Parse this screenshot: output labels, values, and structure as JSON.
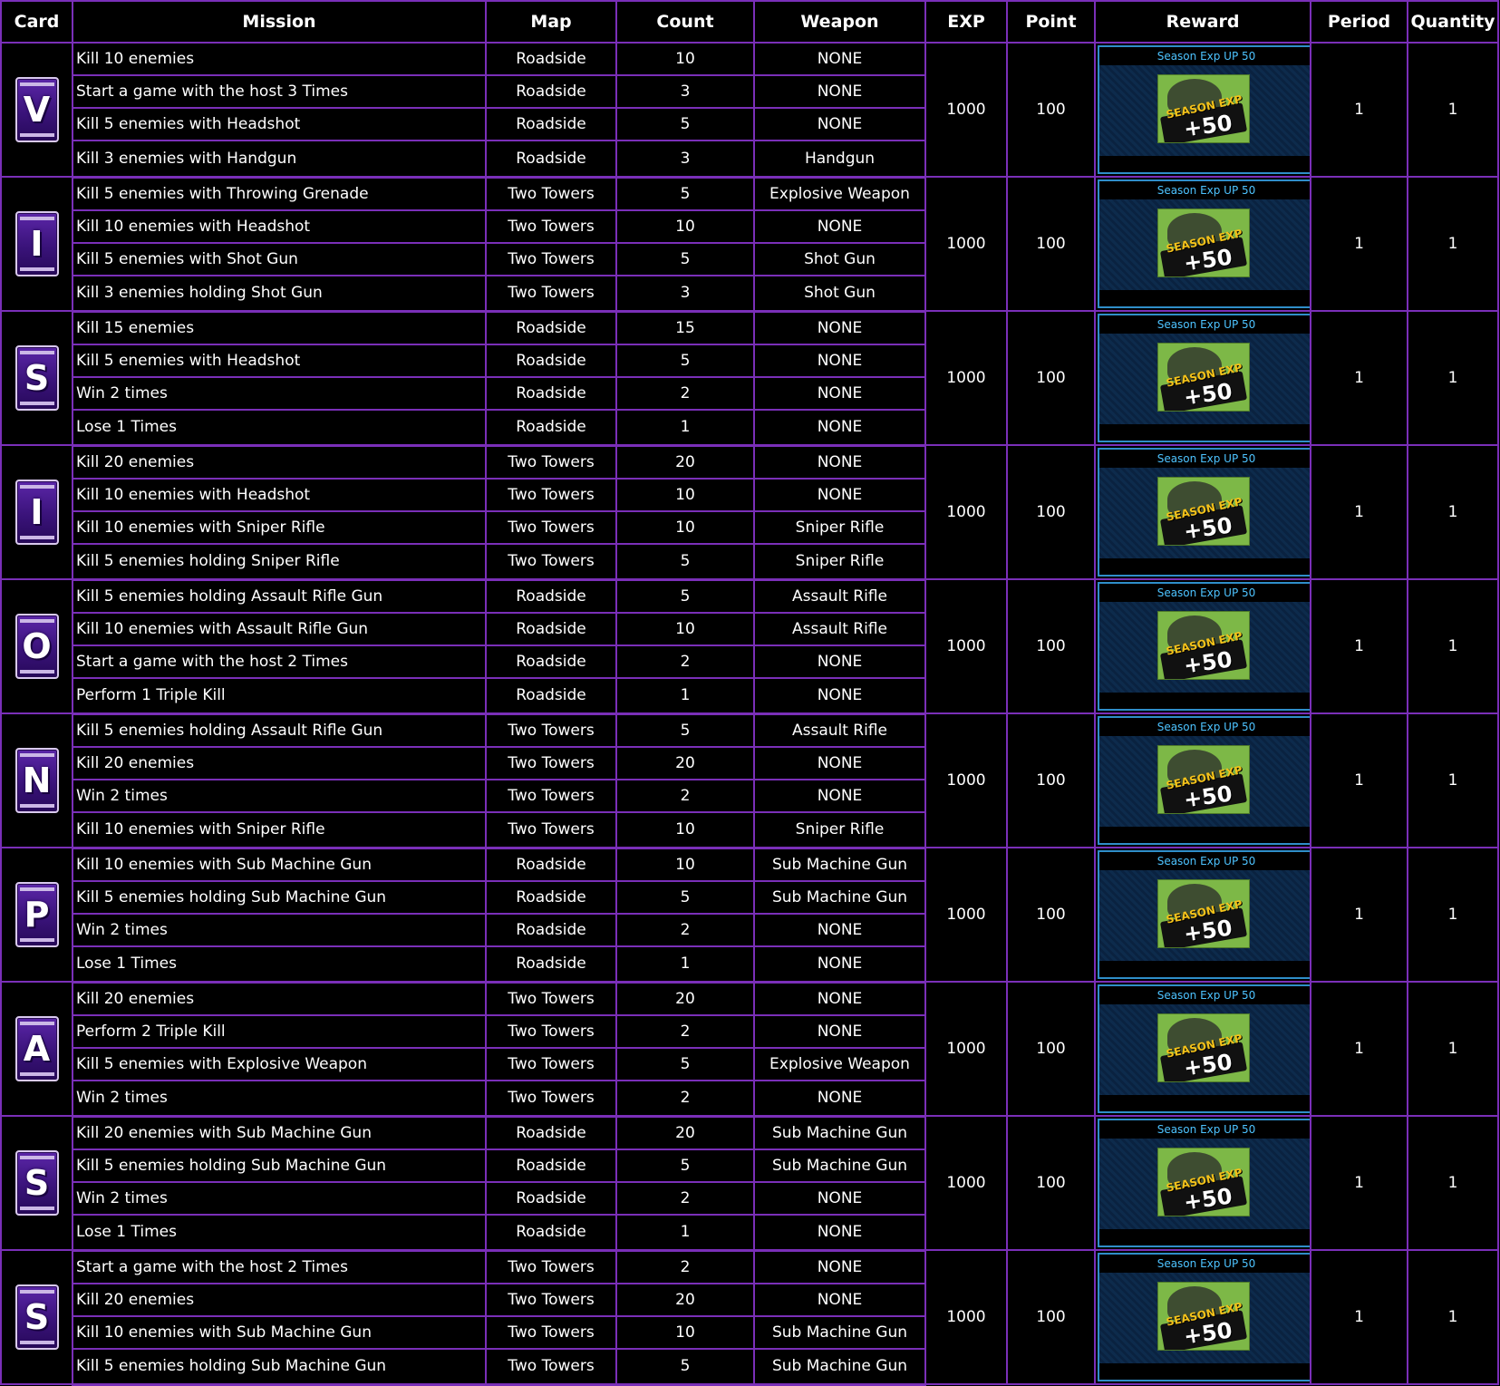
{
  "headers": [
    "Card",
    "Mission",
    "Map",
    "Count",
    "Weapon",
    "EXP",
    "Point",
    "Reward",
    "Period",
    "Quantity"
  ],
  "reward": {
    "title": "Season Exp UP 50",
    "icon_label": "SEASON EXP",
    "icon_amount": "+50"
  },
  "colors": {
    "border": "#7a2fb8",
    "card_purple": "#4a1c96",
    "reward_text": "#4dc3ff",
    "reward_frame": "#2f8ec9"
  },
  "groups": [
    {
      "card": "V",
      "exp": "1000",
      "point": "100",
      "period": "1",
      "quantity": "1",
      "missions": [
        {
          "mission": "Kill 10 enemies",
          "map": "Roadside",
          "count": "10",
          "weapon": "NONE"
        },
        {
          "mission": "Start a game with the host 3 Times",
          "map": "Roadside",
          "count": "3",
          "weapon": "NONE"
        },
        {
          "mission": "Kill 5 enemies with Headshot",
          "map": "Roadside",
          "count": "5",
          "weapon": "NONE"
        },
        {
          "mission": "Kill 3 enemies with Handgun",
          "map": "Roadside",
          "count": "3",
          "weapon": "Handgun"
        }
      ]
    },
    {
      "card": "I",
      "exp": "1000",
      "point": "100",
      "period": "1",
      "quantity": "1",
      "missions": [
        {
          "mission": "Kill 5 enemies with Throwing Grenade",
          "map": "Two Towers",
          "count": "5",
          "weapon": "Explosive Weapon"
        },
        {
          "mission": "Kill 10 enemies with Headshot",
          "map": "Two Towers",
          "count": "10",
          "weapon": "NONE"
        },
        {
          "mission": "Kill 5 enemies with Shot Gun",
          "map": "Two Towers",
          "count": "5",
          "weapon": "Shot Gun"
        },
        {
          "mission": "Kill 3 enemies holding Shot Gun",
          "map": "Two Towers",
          "count": "3",
          "weapon": "Shot Gun"
        }
      ]
    },
    {
      "card": "S",
      "exp": "1000",
      "point": "100",
      "period": "1",
      "quantity": "1",
      "missions": [
        {
          "mission": "Kill 15 enemies",
          "map": "Roadside",
          "count": "15",
          "weapon": "NONE"
        },
        {
          "mission": "Kill 5 enemies with Headshot",
          "map": "Roadside",
          "count": "5",
          "weapon": "NONE"
        },
        {
          "mission": "Win 2 times",
          "map": "Roadside",
          "count": "2",
          "weapon": "NONE"
        },
        {
          "mission": "Lose 1 Times",
          "map": "Roadside",
          "count": "1",
          "weapon": "NONE"
        }
      ]
    },
    {
      "card": "I",
      "exp": "1000",
      "point": "100",
      "period": "1",
      "quantity": "1",
      "missions": [
        {
          "mission": "Kill 20 enemies",
          "map": "Two Towers",
          "count": "20",
          "weapon": "NONE"
        },
        {
          "mission": "Kill 10 enemies with Headshot",
          "map": "Two Towers",
          "count": "10",
          "weapon": "NONE"
        },
        {
          "mission": "Kill 10 enemies with Sniper Rifle",
          "map": "Two Towers",
          "count": "10",
          "weapon": "Sniper Rifle"
        },
        {
          "mission": "Kill 5 enemies holding Sniper Rifle",
          "map": "Two Towers",
          "count": "5",
          "weapon": "Sniper Rifle"
        }
      ]
    },
    {
      "card": "O",
      "exp": "1000",
      "point": "100",
      "period": "1",
      "quantity": "1",
      "missions": [
        {
          "mission": "Kill 5 enemies holding Assault Rifle Gun",
          "map": "Roadside",
          "count": "5",
          "weapon": "Assault Rifle"
        },
        {
          "mission": "Kill 10 enemies with Assault Rifle Gun",
          "map": "Roadside",
          "count": "10",
          "weapon": "Assault Rifle"
        },
        {
          "mission": "Start a game with the host 2 Times",
          "map": "Roadside",
          "count": "2",
          "weapon": "NONE"
        },
        {
          "mission": "Perform 1 Triple Kill",
          "map": "Roadside",
          "count": "1",
          "weapon": "NONE"
        }
      ]
    },
    {
      "card": "N",
      "exp": "1000",
      "point": "100",
      "period": "1",
      "quantity": "1",
      "missions": [
        {
          "mission": "Kill 5 enemies holding Assault Rifle Gun",
          "map": "Two Towers",
          "count": "5",
          "weapon": "Assault Rifle"
        },
        {
          "mission": "Kill 20 enemies",
          "map": "Two Towers",
          "count": "20",
          "weapon": "NONE"
        },
        {
          "mission": "Win 2 times",
          "map": "Two Towers",
          "count": "2",
          "weapon": "NONE"
        },
        {
          "mission": "Kill 10 enemies with Sniper Rifle",
          "map": "Two Towers",
          "count": "10",
          "weapon": "Sniper Rifle"
        }
      ]
    },
    {
      "card": "P",
      "exp": "1000",
      "point": "100",
      "period": "1",
      "quantity": "1",
      "missions": [
        {
          "mission": "Kill 10 enemies with Sub Machine Gun",
          "map": "Roadside",
          "count": "10",
          "weapon": "Sub Machine Gun"
        },
        {
          "mission": "Kill 5 enemies holding Sub Machine Gun",
          "map": "Roadside",
          "count": "5",
          "weapon": "Sub Machine Gun"
        },
        {
          "mission": "Win 2 times",
          "map": "Roadside",
          "count": "2",
          "weapon": "NONE"
        },
        {
          "mission": "Lose 1 Times",
          "map": "Roadside",
          "count": "1",
          "weapon": "NONE"
        }
      ]
    },
    {
      "card": "A",
      "exp": "1000",
      "point": "100",
      "period": "1",
      "quantity": "1",
      "missions": [
        {
          "mission": "Kill 20 enemies",
          "map": "Two Towers",
          "count": "20",
          "weapon": "NONE"
        },
        {
          "mission": "Perform 2 Triple Kill",
          "map": "Two Towers",
          "count": "2",
          "weapon": "NONE"
        },
        {
          "mission": "Kill 5 enemies with Explosive Weapon",
          "map": "Two Towers",
          "count": "5",
          "weapon": "Explosive Weapon"
        },
        {
          "mission": "Win 2 times",
          "map": "Two Towers",
          "count": "2",
          "weapon": "NONE"
        }
      ]
    },
    {
      "card": "S",
      "exp": "1000",
      "point": "100",
      "period": "1",
      "quantity": "1",
      "missions": [
        {
          "mission": "Kill 20 enemies with Sub Machine Gun",
          "map": "Roadside",
          "count": "20",
          "weapon": "Sub Machine Gun"
        },
        {
          "mission": "Kill 5 enemies holding Sub Machine Gun",
          "map": "Roadside",
          "count": "5",
          "weapon": "Sub Machine Gun"
        },
        {
          "mission": "Win 2 times",
          "map": "Roadside",
          "count": "2",
          "weapon": "NONE"
        },
        {
          "mission": "Lose 1 Times",
          "map": "Roadside",
          "count": "1",
          "weapon": "NONE"
        }
      ]
    },
    {
      "card": "S",
      "exp": "1000",
      "point": "100",
      "period": "1",
      "quantity": "1",
      "missions": [
        {
          "mission": "Start a game with the host 2 Times",
          "map": "Two Towers",
          "count": "2",
          "weapon": "NONE"
        },
        {
          "mission": "Kill 20 enemies",
          "map": "Two Towers",
          "count": "20",
          "weapon": "NONE"
        },
        {
          "mission": "Kill 10 enemies with Sub Machine Gun",
          "map": "Two Towers",
          "count": "10",
          "weapon": "Sub Machine Gun"
        },
        {
          "mission": "Kill 5 enemies holding Sub Machine Gun",
          "map": "Two Towers",
          "count": "5",
          "weapon": "Sub Machine Gun"
        }
      ]
    }
  ]
}
